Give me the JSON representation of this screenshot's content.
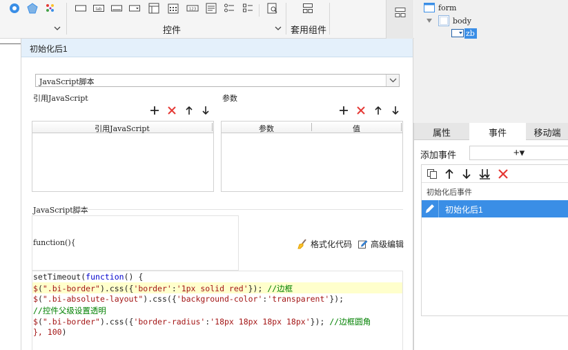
{
  "toolbar": {
    "controls_group_label": "控件",
    "composite_group_label": "套用组件"
  },
  "dialog": {
    "title": "初始化后1",
    "script_type": "JavaScript脚本",
    "ref_js_label": "引用JavaScript",
    "params_label": "参数",
    "ref_js_table": {
      "columns": [
        "引用JavaScript"
      ]
    },
    "params_table": {
      "columns": [
        "参数",
        "值"
      ]
    },
    "script_label": "JavaScript脚本",
    "function_header": "function(){",
    "format_code_label": "格式化代码",
    "advanced_edit_label": "高级编辑",
    "code_lines": [
      "setTimeout(function() {",
      "$(\".bi-border\").css({'border':'1px solid red'}); //边框",
      "$(\".bi-absolute-layout\").css({'background-color':'transparent'});",
      "//控件父级设置透明",
      "$(\".bi-border\").css({'border-radius':'18px 18px 18px 18px'}); //边框圆角",
      "}, 100)"
    ]
  },
  "tree": {
    "root": "form",
    "body": "body",
    "widget": "zb"
  },
  "right_panel": {
    "tabs": [
      "属性",
      "事件",
      "移动端"
    ],
    "add_event_label": "添加事件",
    "add_event_icon": "+▾",
    "event_group": "初始化后事件",
    "event_item": "初始化后1"
  },
  "colors": {
    "accent": "#3a8ee6",
    "title_bar": "#e4f0fb",
    "highlight_line": "#ffffcc",
    "delete_red": "#e53935"
  }
}
